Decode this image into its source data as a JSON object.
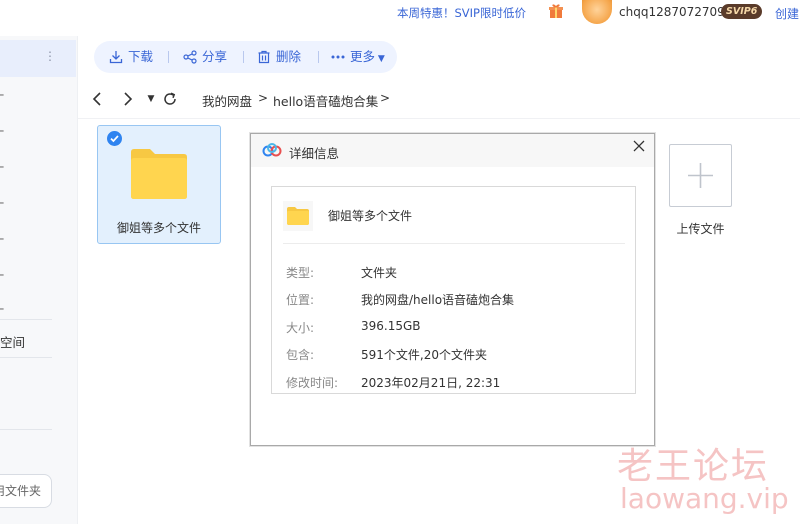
{
  "topbar": {
    "promo": "本周特惠！SVIP限时低价",
    "username": "chqq1287072709",
    "vip_badge": "SVIP6",
    "create_link": "创建"
  },
  "sidebar": {
    "space_label": "空间",
    "new_folder": "用文件夹"
  },
  "toolbar": {
    "download": "下载",
    "share": "分享",
    "delete": "删除",
    "more": "更多"
  },
  "breadcrumb": {
    "root": "我的网盘",
    "current": "hello语音磕炮合集"
  },
  "files": [
    {
      "name": "御姐等多个文件",
      "selected": true
    }
  ],
  "upload": {
    "label": "上传文件"
  },
  "dialog": {
    "title": "详细信息",
    "item_name": "御姐等多个文件",
    "rows": [
      {
        "key": "类型:",
        "value": "文件夹"
      },
      {
        "key": "位置:",
        "value": "我的网盘/hello语音磕炮合集"
      },
      {
        "key": "大小:",
        "value": "396.15GB"
      },
      {
        "key": "包含:",
        "value": "591个文件,20个文件夹"
      },
      {
        "key": "修改时间:",
        "value": "2023年02月21日, 22:31"
      }
    ]
  },
  "watermark": {
    "cn": "老王论坛",
    "en": "laowang.vip"
  },
  "colors": {
    "accent": "#3a66d6",
    "folder": "#ffd54f",
    "selected_bg": "#e3f0fd"
  }
}
